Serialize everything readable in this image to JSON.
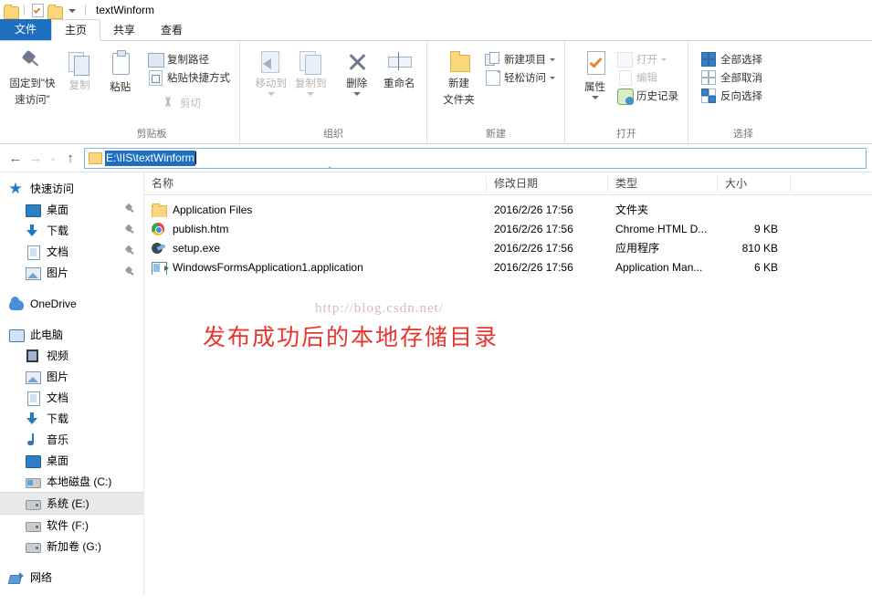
{
  "window": {
    "title": "textWinform",
    "quick_access_icons": [
      "folder-icon",
      "properties-icon",
      "new-folder-icon",
      "customize-dropdown-icon"
    ]
  },
  "ribbon": {
    "tabs": [
      {
        "label": "文件",
        "type": "file"
      },
      {
        "label": "主页",
        "type": "active"
      },
      {
        "label": "共享",
        "type": "normal"
      },
      {
        "label": "查看",
        "type": "normal"
      }
    ],
    "groups": [
      {
        "name": "剪贴板",
        "big_buttons": [
          {
            "label": "固定到\"快\n速访问\"",
            "line1": "固定到\"快",
            "line2": "速访问\"",
            "icon": "pin-icon",
            "disabled": false
          },
          {
            "label": "复制",
            "icon": "copy-icon",
            "disabled": true
          },
          {
            "label": "粘贴",
            "icon": "paste-icon",
            "disabled": false
          }
        ],
        "small_buttons": [
          {
            "label": "复制路径",
            "icon": "copy-path-icon",
            "disabled": false
          },
          {
            "label": "粘贴快捷方式",
            "icon": "paste-shortcut-icon",
            "disabled": false
          },
          {
            "label": "剪切",
            "icon": "cut-icon",
            "disabled": true
          }
        ]
      },
      {
        "name": "组织",
        "big_buttons": [
          {
            "label": "移动到",
            "icon": "move-to-icon",
            "disabled": true,
            "dropdown": true
          },
          {
            "label": "复制到",
            "icon": "copy-to-icon",
            "disabled": true,
            "dropdown": true
          },
          {
            "label": "删除",
            "icon": "delete-icon",
            "disabled": false,
            "dropdown": true
          },
          {
            "label": "重命名",
            "icon": "rename-icon",
            "disabled": false
          }
        ]
      },
      {
        "name": "新建",
        "big_buttons": [
          {
            "line1": "新建",
            "line2": "文件夹",
            "icon": "new-folder-icon",
            "disabled": false
          }
        ],
        "small_buttons": [
          {
            "label": "新建项目",
            "icon": "new-item-icon",
            "dropdown": true
          },
          {
            "label": "轻松访问",
            "icon": "easy-access-icon",
            "dropdown": true
          }
        ]
      },
      {
        "name": "打开",
        "big_buttons": [
          {
            "label": "属性",
            "icon": "properties-icon",
            "disabled": false,
            "dropdown": true
          }
        ],
        "small_buttons": [
          {
            "label": "打开",
            "icon": "open-icon",
            "disabled": true,
            "dropdown": true
          },
          {
            "label": "编辑",
            "icon": "edit-icon",
            "disabled": true
          },
          {
            "label": "历史记录",
            "icon": "history-icon",
            "disabled": false
          }
        ]
      },
      {
        "name": "选择",
        "small_buttons": [
          {
            "label": "全部选择",
            "icon": "select-all-icon"
          },
          {
            "label": "全部取消",
            "icon": "select-none-icon"
          },
          {
            "label": "反向选择",
            "icon": "invert-selection-icon"
          }
        ]
      }
    ]
  },
  "address": {
    "back_icon": "←",
    "forward_icon": "→",
    "recent_icon": "⌄",
    "up_icon": "↑",
    "path": "E:\\IIS\\textWinform"
  },
  "sidebar": {
    "sections": [
      {
        "header": {
          "label": "快速访问",
          "icon": "star-icon"
        },
        "items": [
          {
            "label": "桌面",
            "icon": "desktop-icon",
            "pinned": true
          },
          {
            "label": "下载",
            "icon": "downloads-icon",
            "pinned": true
          },
          {
            "label": "文档",
            "icon": "documents-icon",
            "pinned": true
          },
          {
            "label": "图片",
            "icon": "pictures-icon",
            "pinned": true
          }
        ]
      },
      {
        "header": {
          "label": "OneDrive",
          "icon": "cloud-icon"
        },
        "items": []
      },
      {
        "header": {
          "label": "此电脑",
          "icon": "this-pc-icon"
        },
        "items": [
          {
            "label": "视频",
            "icon": "video-icon",
            "pinned": false
          },
          {
            "label": "图片",
            "icon": "pictures-icon",
            "pinned": false
          },
          {
            "label": "文档",
            "icon": "documents-icon",
            "pinned": false
          },
          {
            "label": "下载",
            "icon": "downloads-icon",
            "pinned": false
          },
          {
            "label": "音乐",
            "icon": "music-icon",
            "pinned": false
          },
          {
            "label": "桌面",
            "icon": "desktop-icon",
            "pinned": false
          },
          {
            "label": "本地磁盘 (C:)",
            "icon": "system-drive-icon",
            "pinned": false
          },
          {
            "label": "系统 (E:)",
            "icon": "drive-icon",
            "pinned": false,
            "selected": true
          },
          {
            "label": "软件 (F:)",
            "icon": "drive-icon",
            "pinned": false
          },
          {
            "label": "新加卷 (G:)",
            "icon": "drive-icon",
            "pinned": false
          }
        ]
      },
      {
        "header": {
          "label": "网络",
          "icon": "network-icon"
        },
        "items": []
      }
    ]
  },
  "filelist": {
    "columns": [
      {
        "label": "名称",
        "key": "name"
      },
      {
        "label": "修改日期",
        "key": "date"
      },
      {
        "label": "类型",
        "key": "type"
      },
      {
        "label": "大小",
        "key": "size"
      }
    ],
    "rows": [
      {
        "name": "Application Files",
        "date": "2016/2/26 17:56",
        "type": "文件夹",
        "size": "",
        "icon": "folder-icon"
      },
      {
        "name": "publish.htm",
        "date": "2016/2/26 17:56",
        "type": "Chrome HTML D...",
        "size": "9 KB",
        "icon": "chrome-html-icon"
      },
      {
        "name": "setup.exe",
        "date": "2016/2/26 17:56",
        "type": "应用程序",
        "size": "810 KB",
        "icon": "executable-icon"
      },
      {
        "name": "WindowsFormsApplication1.application",
        "date": "2016/2/26 17:56",
        "type": "Application Man...",
        "size": "6 KB",
        "icon": "application-manifest-icon"
      }
    ]
  },
  "annotations": {
    "watermark": "http://blog.csdn.net/",
    "red_note": "发布成功后的本地存储目录",
    "red_color": "#e8352f"
  }
}
